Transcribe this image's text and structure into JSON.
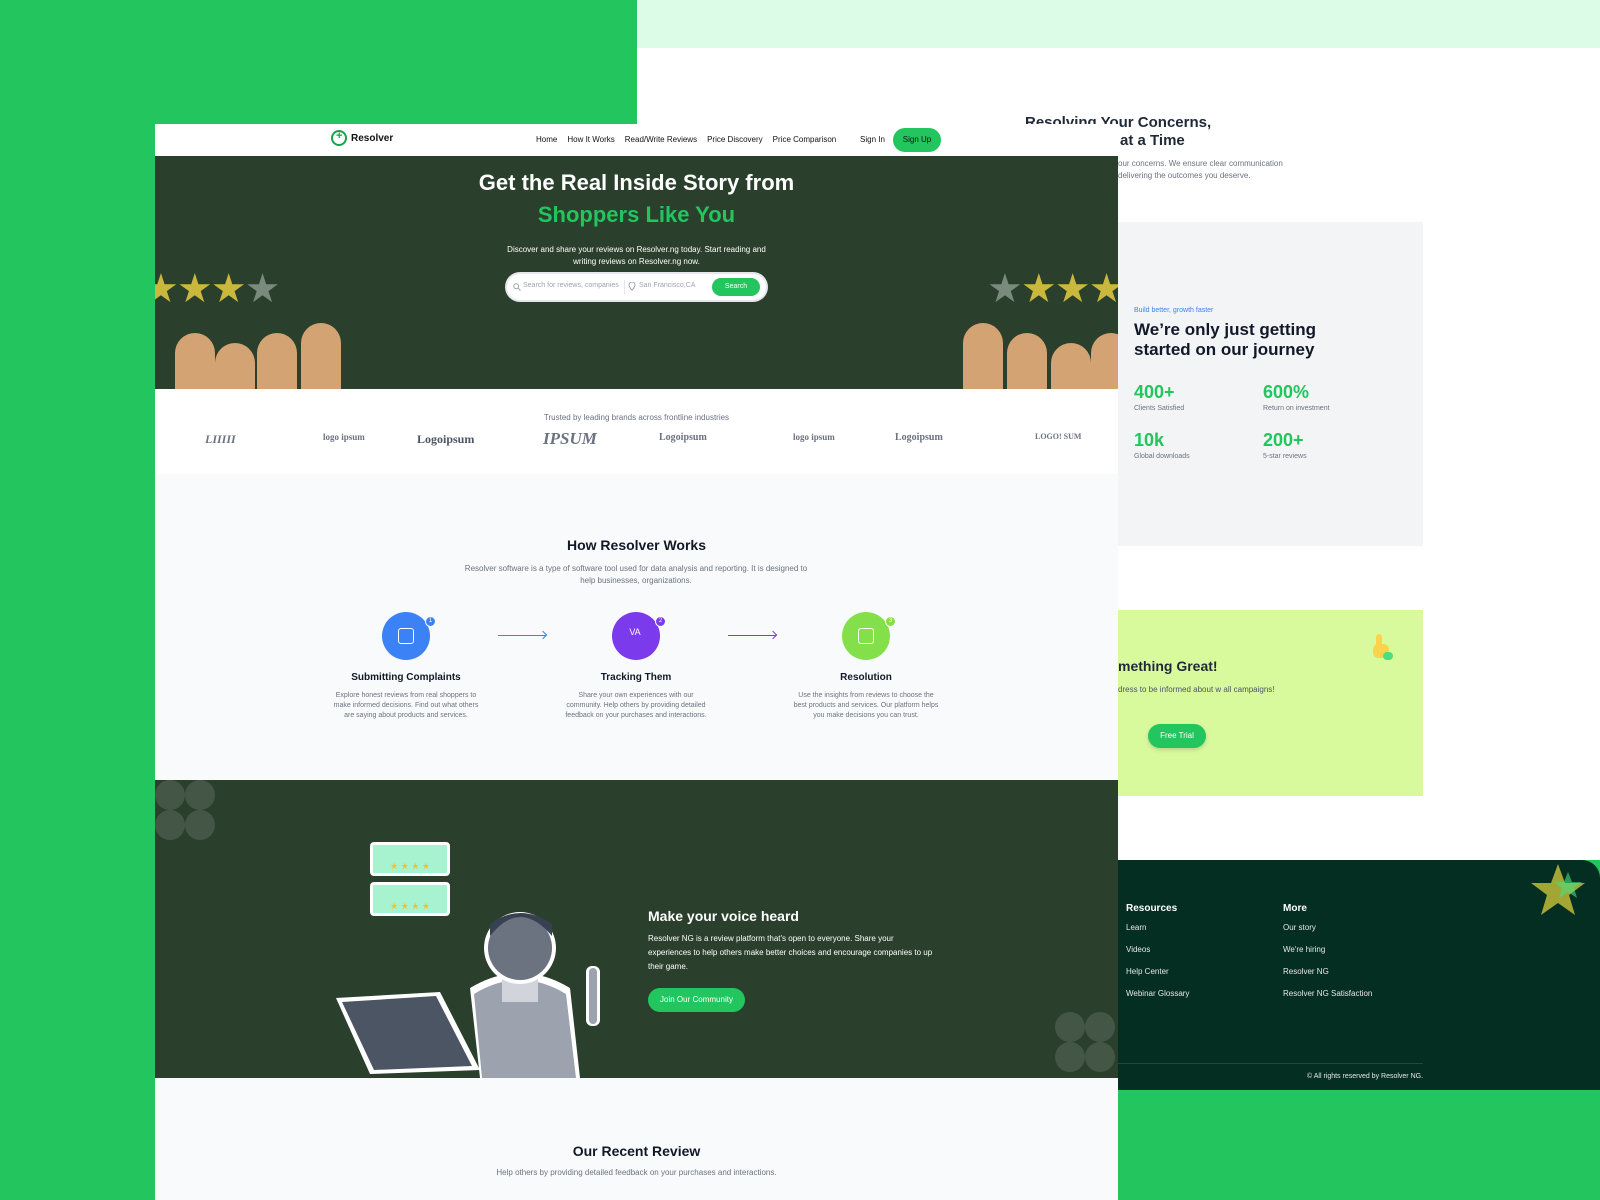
{
  "nav": {
    "brand": "Resolver",
    "links": [
      "Home",
      "How It Works",
      "Read/Write Reviews",
      "Price Discovery",
      "Price Comparison"
    ],
    "sign_in": "Sign In",
    "sign_up": "Sign Up"
  },
  "hero": {
    "title_line1": "Get the Real Inside Story from",
    "title_line2": "Shoppers Like You",
    "description": "Discover and share your reviews on Resolver.ng today. Start reading and writing reviews on Resolver.ng now.",
    "search_placeholder": "Search for reviews, companies",
    "location_placeholder": "San Francisco,CA",
    "search_button": "Search"
  },
  "brands": {
    "caption": "Trusted by leading brands across frontline industries",
    "logos": [
      "LIIIII",
      "logo ipsum",
      "Logoipsum",
      "IPSUM",
      "Logoipsum",
      "logo ipsum",
      "Logoipsum",
      "LOGO! SUM"
    ]
  },
  "works": {
    "title": "How Resolver Works",
    "description": "Resolver software is a type of software tool used for data analysis and reporting. It is designed to help businesses, organizations.",
    "steps": [
      {
        "num": "1",
        "title": "Submitting Complaints",
        "text": "Explore honest reviews from real shoppers to make informed decisions. Find out what others are saying about products and services.",
        "color": "#3b82f6"
      },
      {
        "num": "2",
        "title": "Tracking Them",
        "text": "Share your own experiences with our community. Help others by providing detailed feedback on your purchases and interactions.",
        "color": "#7c3aed"
      },
      {
        "num": "3",
        "title": "Resolution",
        "text": "Use the insights from reviews to choose the best products and services. Our platform helps you make decisions you can trust.",
        "color": "#84e04a"
      }
    ]
  },
  "voice": {
    "title": "Make your voice heard",
    "text": "Resolver NG is a review platform that's open to everyone. Share your experiences to help others make better choices and encourage companies to up their game.",
    "button": "Join Our Community"
  },
  "recent": {
    "title": "Our Recent Review",
    "description": "Help others by providing detailed feedback on your purchases and interactions."
  },
  "back": {
    "title_line1": "Resolving Your Concerns,",
    "title_line2": "at a Time",
    "sub": "our concerns. We ensure clear communication delivering the outcomes you deserve.",
    "stats_tag": "Build better, growth faster",
    "stats_title": "We’re only just getting started on our journey",
    "stats": [
      {
        "value": "400+",
        "label": "Clients Satisfied"
      },
      {
        "value": "600%",
        "label": "Return on investment"
      },
      {
        "value": "10k",
        "label": "Global downloads"
      },
      {
        "value": "200+",
        "label": "5-star reviews"
      }
    ],
    "cta_title": "mething Great!",
    "cta_text": "dress to be informed about w all campaigns!",
    "cta_button": "Free Trial",
    "footer": {
      "resources_title": "Resources",
      "resources": [
        "Learn",
        "Videos",
        "Help Center",
        "Webinar Glossary"
      ],
      "more_title": "More",
      "more": [
        "Our story",
        "We're hiring",
        "Resolver NG",
        "Resolver NG Satisfaction"
      ],
      "copyright": "© All rights reserved by Resolver NG."
    }
  },
  "colors": {
    "accent": "#22c55e",
    "dark": "#2a3f2c",
    "footer": "#052e22"
  }
}
